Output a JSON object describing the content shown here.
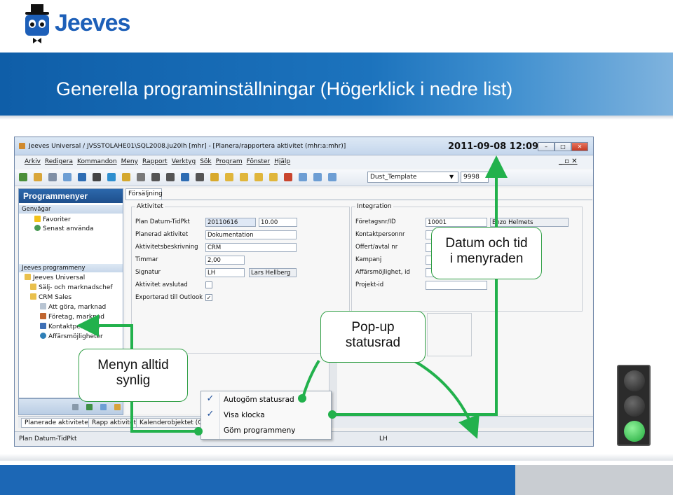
{
  "logo": {
    "text": "Jeeves"
  },
  "slide": {
    "title": "Generella programinställningar  (Högerklick i nedre list)"
  },
  "window": {
    "title": "Jeeves Universal / JVSSTOLAHE01\\SQL2008.ju20lh [mhr] - [Planera/rapportera aktivitet (mhr:a:mhr)]",
    "clock": "2011-09-08 12:09",
    "menu": [
      "Arkiv",
      "Redigera",
      "Kommandon",
      "Meny",
      "Rapport",
      "Verktyg",
      "Sök",
      "Program",
      "Fönster",
      "Hjälp"
    ],
    "template": "Dust_Template",
    "template_num": "9998"
  },
  "sidebar": {
    "title": "Programmenyer",
    "shortcuts_header": "Genvägar",
    "shortcuts": [
      "Favoriter",
      "Senast använda"
    ],
    "programs_header": "Jeeves programmeny",
    "tree": [
      "Jeeves Universal",
      "Sälj- och marknadschef",
      "CRM Sales",
      "Att göra, marknad",
      "Företag, marknad",
      "Kontaktpersoner",
      "Affärsmöjligheter"
    ]
  },
  "form": {
    "tab": "Försäljning",
    "activity_group": "Aktivitet",
    "integration_group": "Integration",
    "fields": {
      "plan_label": "Plan Datum-TidPkt",
      "plan_date": "20110616",
      "plan_time": "10.00",
      "planned_label": "Planerad aktivitet",
      "planned_value": "Dokumentation",
      "desc_label": "Aktivitetsbeskrivning",
      "desc_value": "CRM",
      "hours_label": "Timmar",
      "hours_value": "2,00",
      "sig_label": "Signatur",
      "sig_value": "LH",
      "sig_name": "Lars Hellberg",
      "done_label": "Aktivitet avslutad",
      "export_label": "Exporterad till Outlook"
    },
    "integration": {
      "company_label": "Företagsnr/ID",
      "company_value": "10001",
      "company_name": "Enzo Helmets",
      "contact_label": "Kontaktpersonnr",
      "offer_label": "Offert/avtal nr",
      "campaign_label": "Kampanj",
      "opp_label": "Affärsmöjlighet, id",
      "project_label": "Projekt-id"
    }
  },
  "bottom_tabs": [
    "Planerade aktiviteter",
    "Rapp aktivitet",
    "Kalenderobjektet (Cale"
  ],
  "status": {
    "left": "Plan Datum-TidPkt",
    "right": "LH"
  },
  "context_menu": [
    {
      "label": "Autogöm statusrad",
      "checked": true
    },
    {
      "label": "Visa klocka",
      "checked": true
    },
    {
      "label": "Göm programmeny",
      "checked": false
    }
  ],
  "callouts": {
    "clock": "Datum och tid\ni menyraden",
    "popup": "Pop-up\nstatusrad",
    "menu": "Menyn alltid\nsynlig"
  },
  "colors": {
    "accent": "#1c67b5",
    "arrow": "#22b14c",
    "callout_border": "#2f9e44"
  },
  "traffic_light": {
    "active": "green"
  }
}
